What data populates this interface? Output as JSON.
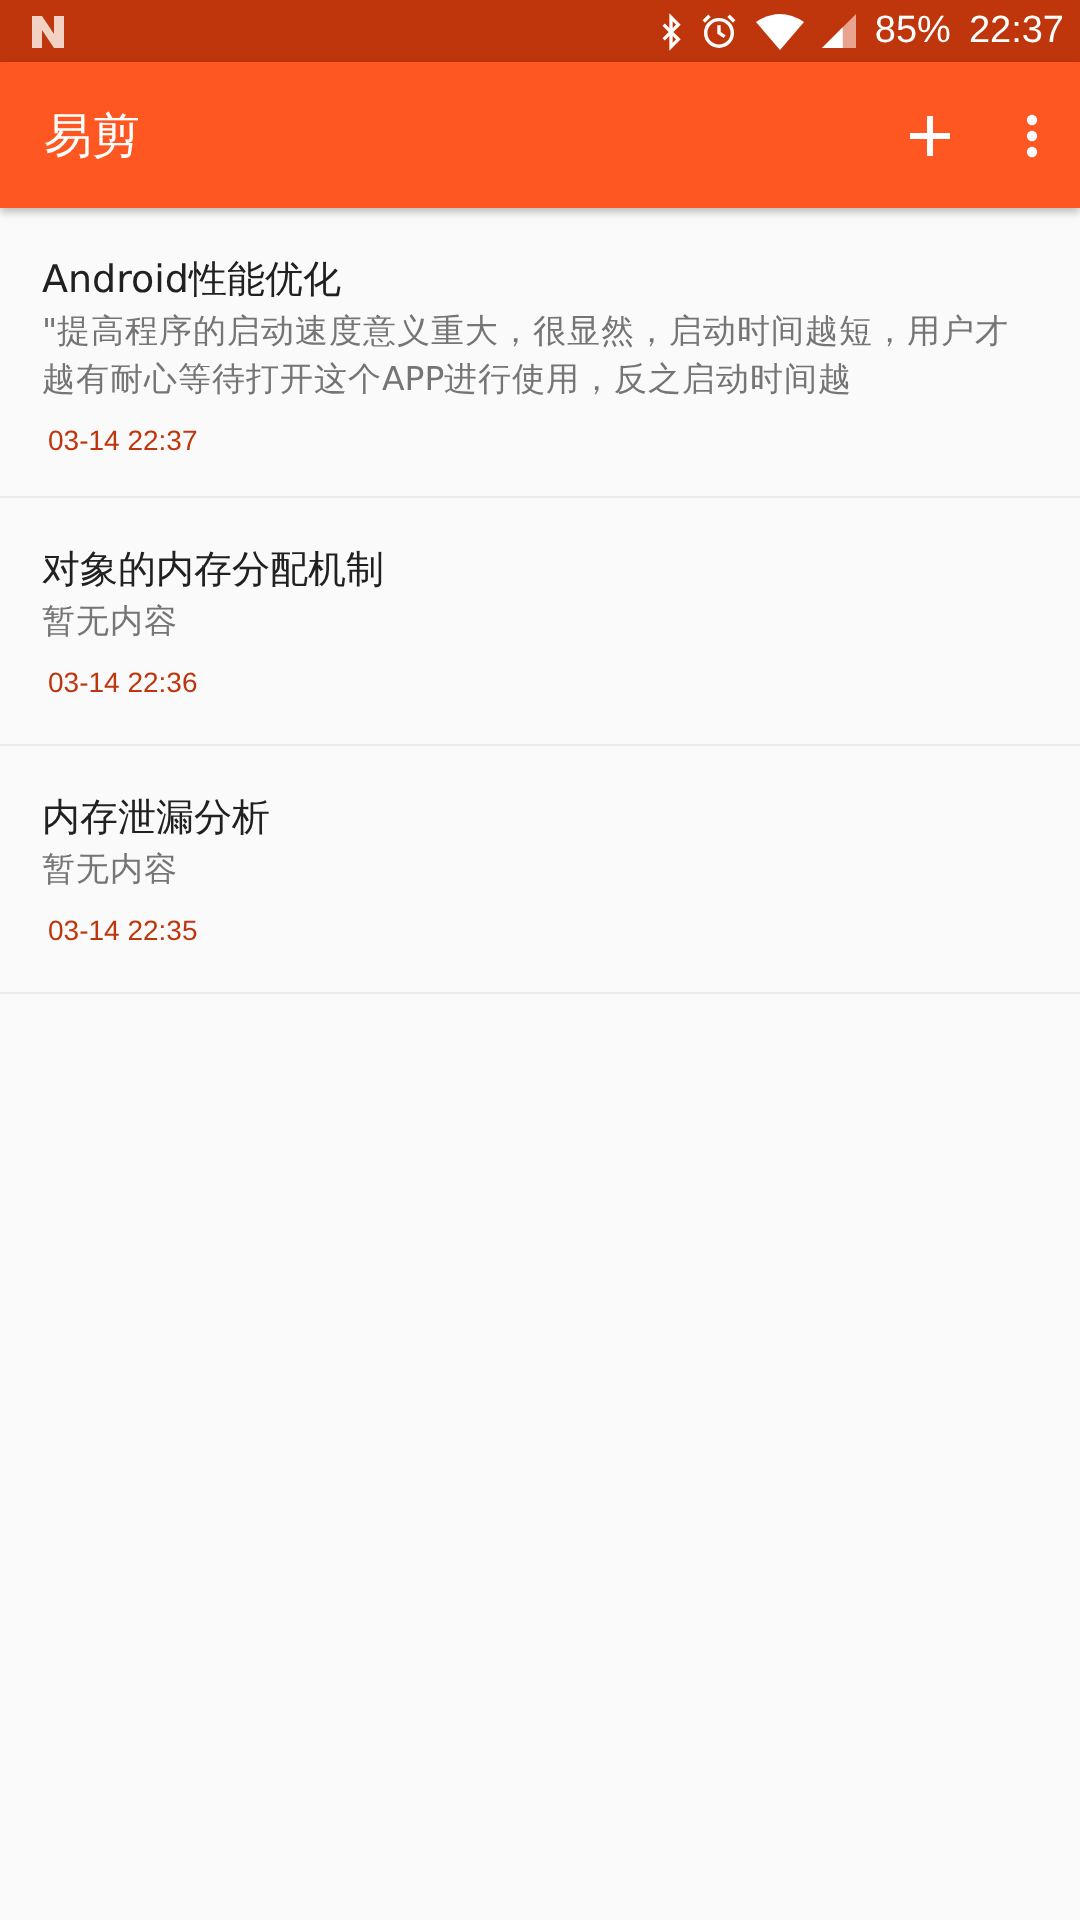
{
  "status_bar": {
    "battery": "85%",
    "time": "22:37"
  },
  "app_bar": {
    "title": "易剪"
  },
  "notes": [
    {
      "title": "Android性能优化",
      "preview": "\"提高程序的启动速度意义重大，很显然，启动时间越短，用户才越有耐心等待打开这个APP进行使用，反之启动时间越",
      "date": "03-14 22:37"
    },
    {
      "title": "对象的内存分配机制",
      "preview": "暂无内容",
      "date": "03-14 22:36"
    },
    {
      "title": "内存泄漏分析",
      "preview": "暂无内容",
      "date": "03-14 22:35"
    }
  ]
}
